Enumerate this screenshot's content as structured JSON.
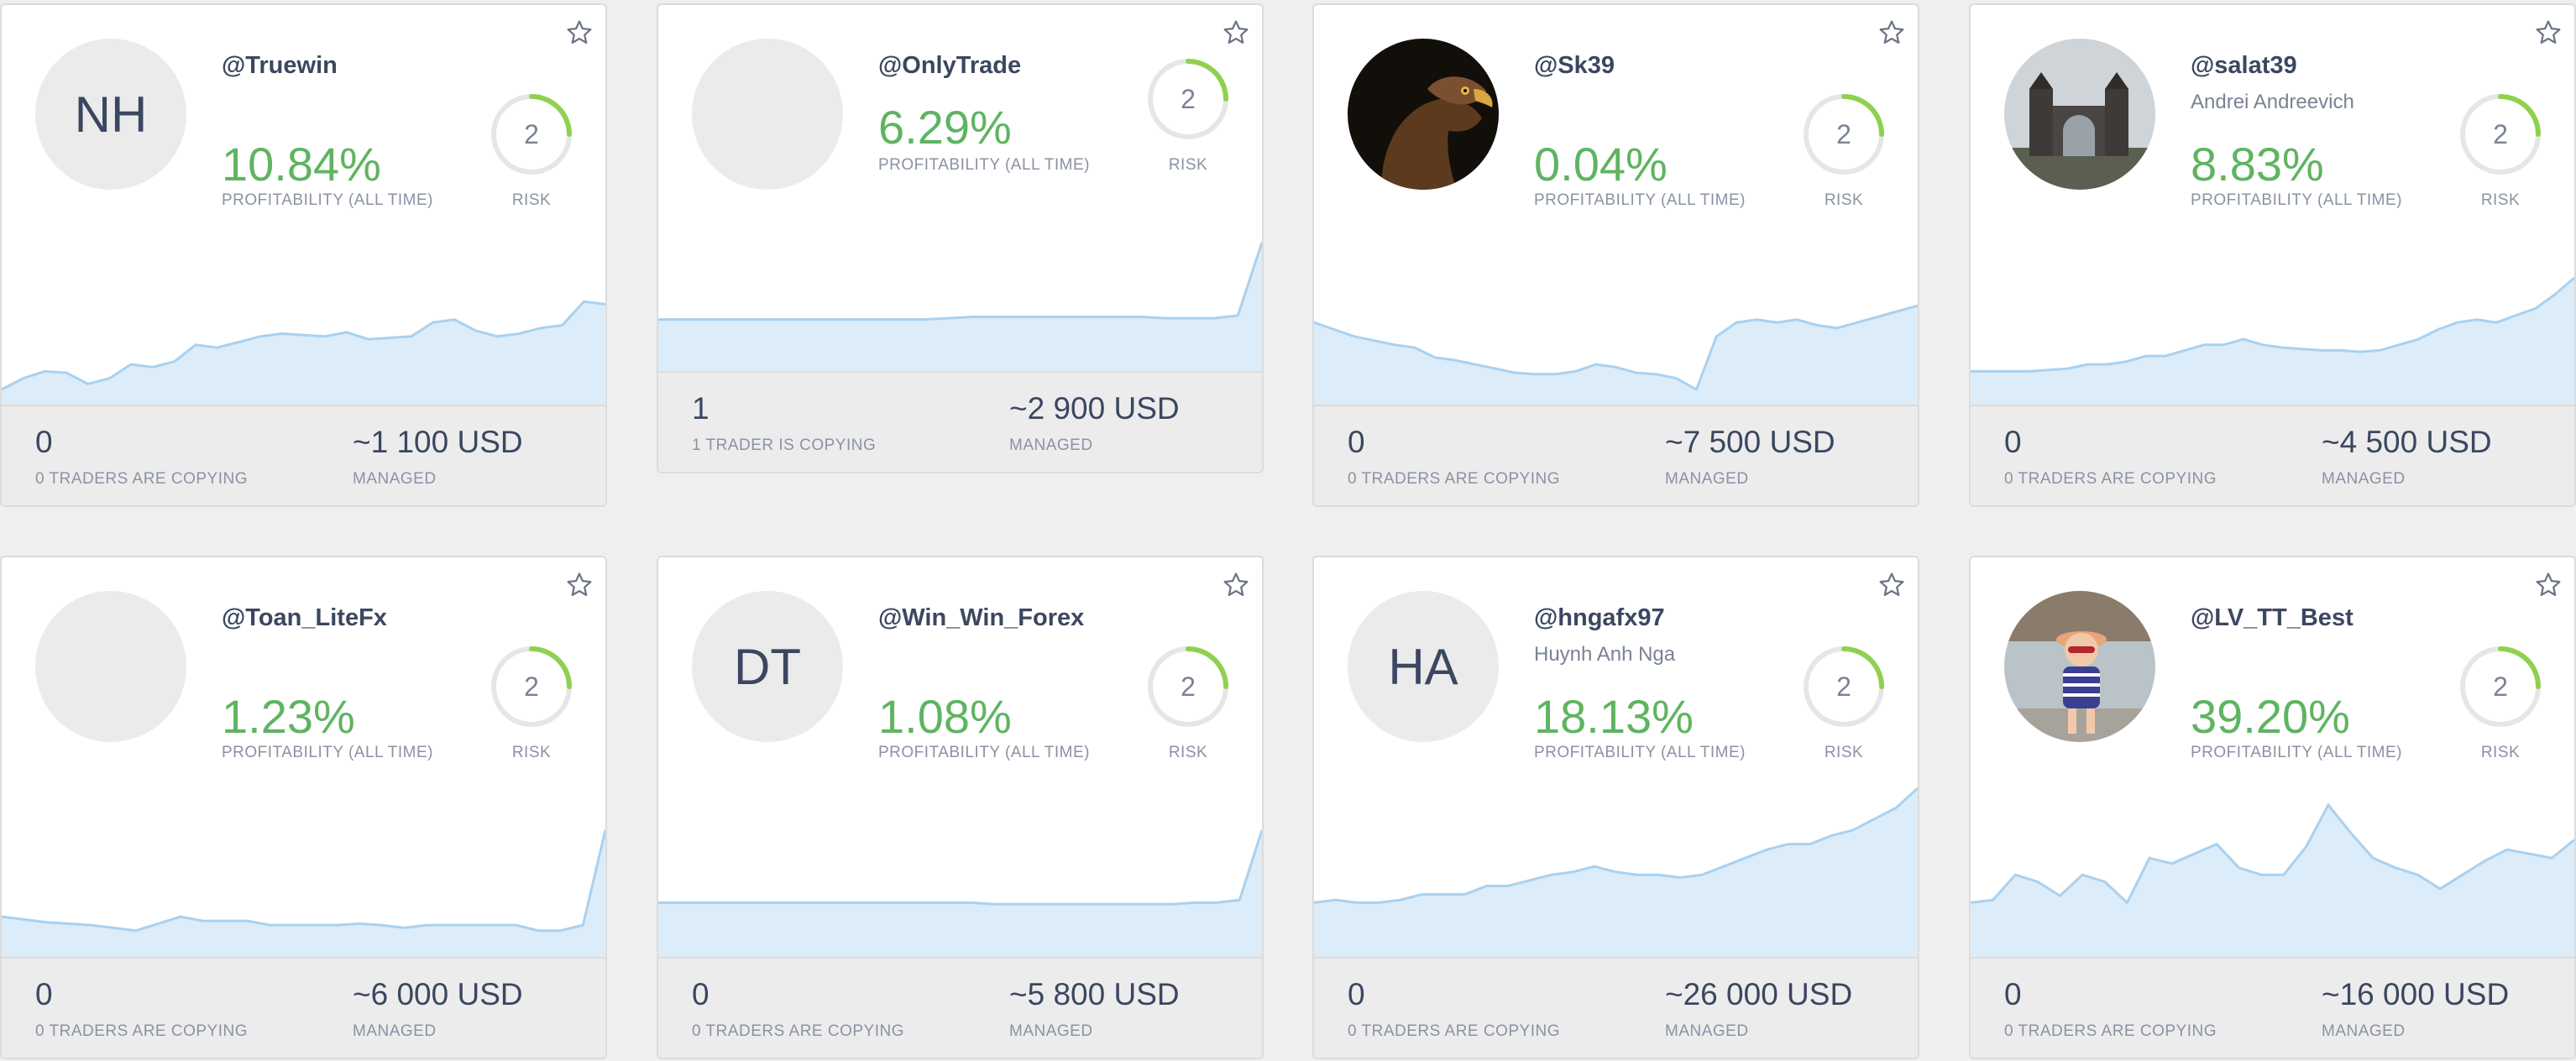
{
  "colors": {
    "profit": "#5fb461",
    "risk_arc": "#8fd14f",
    "chart_fill": "#dcecf9",
    "chart_line": "#a9d1f0"
  },
  "icons": {
    "favorite": "star-outline-icon"
  },
  "traders": [
    {
      "initials": "NH",
      "username": "@Truewin",
      "fullname": "",
      "profit": "10.84%",
      "profit_label": "PROFITABILITY (ALL TIME)",
      "risk": "2",
      "risk_label": "RISK",
      "copiers": "0",
      "copiers_label": "0 TRADERS ARE COPYING",
      "managed": "~1 100 USD",
      "managed_label": "MANAGED",
      "spark": [
        0.12,
        0.2,
        0.25,
        0.24,
        0.16,
        0.2,
        0.3,
        0.28,
        0.32,
        0.44,
        0.42,
        0.46,
        0.5,
        0.52,
        0.51,
        0.5,
        0.53,
        0.48,
        0.49,
        0.5,
        0.6,
        0.62,
        0.54,
        0.5,
        0.52,
        0.56,
        0.58,
        0.75,
        0.73
      ]
    },
    {
      "initials": "",
      "username": "@OnlyTrade",
      "fullname": "",
      "profit": "6.29%",
      "profit_label": "PROFITABILITY (ALL TIME)",
      "risk": "2",
      "risk_label": "RISK",
      "copiers": "1",
      "copiers_label": "1 TRADER IS COPYING",
      "managed": "~2 900 USD",
      "managed_label": "MANAGED",
      "spark": [
        0.4,
        0.4,
        0.4,
        0.4,
        0.4,
        0.4,
        0.4,
        0.4,
        0.4,
        0.4,
        0.4,
        0.4,
        0.41,
        0.42,
        0.42,
        0.42,
        0.42,
        0.42,
        0.42,
        0.42,
        0.42,
        0.41,
        0.41,
        0.41,
        0.43,
        0.98
      ]
    },
    {
      "initials": "",
      "username": "@Sk39",
      "fullname": "",
      "profit": "0.04%",
      "profit_label": "PROFITABILITY (ALL TIME)",
      "risk": "2",
      "risk_label": "RISK",
      "copiers": "0",
      "copiers_label": "0 TRADERS ARE COPYING",
      "managed": "~7 500 USD",
      "managed_label": "MANAGED",
      "spark": [
        0.6,
        0.55,
        0.5,
        0.47,
        0.44,
        0.42,
        0.35,
        0.33,
        0.3,
        0.27,
        0.24,
        0.23,
        0.23,
        0.25,
        0.3,
        0.28,
        0.24,
        0.23,
        0.2,
        0.12,
        0.5,
        0.6,
        0.62,
        0.6,
        0.62,
        0.58,
        0.56,
        0.6,
        0.64,
        0.68,
        0.72
      ]
    },
    {
      "initials": "",
      "username": "@salat39",
      "fullname": "Andrei Andreevich",
      "profit": "8.83%",
      "profit_label": "PROFITABILITY (ALL TIME)",
      "risk": "2",
      "risk_label": "RISK",
      "copiers": "0",
      "copiers_label": "0 TRADERS ARE COPYING",
      "managed": "~4 500 USD",
      "managed_label": "MANAGED",
      "spark": [
        0.25,
        0.25,
        0.25,
        0.25,
        0.26,
        0.27,
        0.3,
        0.3,
        0.32,
        0.36,
        0.36,
        0.4,
        0.44,
        0.44,
        0.48,
        0.44,
        0.42,
        0.41,
        0.4,
        0.4,
        0.39,
        0.4,
        0.44,
        0.48,
        0.55,
        0.6,
        0.62,
        0.6,
        0.65,
        0.7,
        0.8,
        0.92
      ]
    },
    {
      "initials": "",
      "username": "@Toan_LiteFx",
      "fullname": "",
      "profit": "1.23%",
      "profit_label": "PROFITABILITY (ALL TIME)",
      "risk": "2",
      "risk_label": "RISK",
      "copiers": "0",
      "copiers_label": "0 TRADERS ARE COPYING",
      "managed": "~6 000 USD",
      "managed_label": "MANAGED",
      "spark": [
        0.3,
        0.28,
        0.26,
        0.25,
        0.24,
        0.22,
        0.2,
        0.25,
        0.3,
        0.27,
        0.27,
        0.27,
        0.24,
        0.24,
        0.24,
        0.24,
        0.25,
        0.24,
        0.22,
        0.24,
        0.24,
        0.24,
        0.24,
        0.24,
        0.2,
        0.2,
        0.24,
        0.92
      ]
    },
    {
      "initials": "DT",
      "username": "@Win_Win_Forex",
      "fullname": "",
      "profit": "1.08%",
      "profit_label": "PROFITABILITY (ALL TIME)",
      "risk": "2",
      "risk_label": "RISK",
      "copiers": "0",
      "copiers_label": "0 TRADERS ARE COPYING",
      "managed": "~5 800 USD",
      "managed_label": "MANAGED",
      "spark": [
        0.4,
        0.4,
        0.4,
        0.4,
        0.4,
        0.4,
        0.4,
        0.4,
        0.4,
        0.4,
        0.4,
        0.4,
        0.4,
        0.4,
        0.4,
        0.39,
        0.39,
        0.39,
        0.39,
        0.39,
        0.39,
        0.39,
        0.39,
        0.39,
        0.4,
        0.4,
        0.42,
        0.92
      ]
    },
    {
      "initials": "HA",
      "username": "@hngafx97",
      "fullname": "Huynh Anh Nga",
      "profit": "18.13%",
      "profit_label": "PROFITABILITY (ALL TIME)",
      "risk": "2",
      "risk_label": "RISK",
      "copiers": "0",
      "copiers_label": "0 TRADERS ARE COPYING",
      "managed": "~26 000 USD",
      "managed_label": "MANAGED",
      "spark": [
        0.4,
        0.42,
        0.4,
        0.4,
        0.42,
        0.46,
        0.46,
        0.46,
        0.52,
        0.52,
        0.56,
        0.6,
        0.62,
        0.66,
        0.62,
        0.6,
        0.6,
        0.58,
        0.6,
        0.66,
        0.72,
        0.78,
        0.82,
        0.82,
        0.88,
        0.92,
        1.0,
        1.08,
        1.22
      ]
    },
    {
      "initials": "",
      "username": "@LV_TT_Best",
      "fullname": "",
      "profit": "39.20%",
      "profit_label": "PROFITABILITY (ALL TIME)",
      "risk": "2",
      "risk_label": "RISK",
      "copiers": "0",
      "copiers_label": "0 TRADERS ARE COPYING",
      "managed": "~16 000 USD",
      "managed_label": "MANAGED",
      "spark": [
        0.4,
        0.42,
        0.6,
        0.55,
        0.45,
        0.6,
        0.55,
        0.4,
        0.72,
        0.68,
        0.75,
        0.82,
        0.65,
        0.6,
        0.6,
        0.8,
        1.1,
        0.9,
        0.72,
        0.65,
        0.6,
        0.5,
        0.6,
        0.7,
        0.78,
        0.75,
        0.72,
        0.85
      ]
    }
  ]
}
